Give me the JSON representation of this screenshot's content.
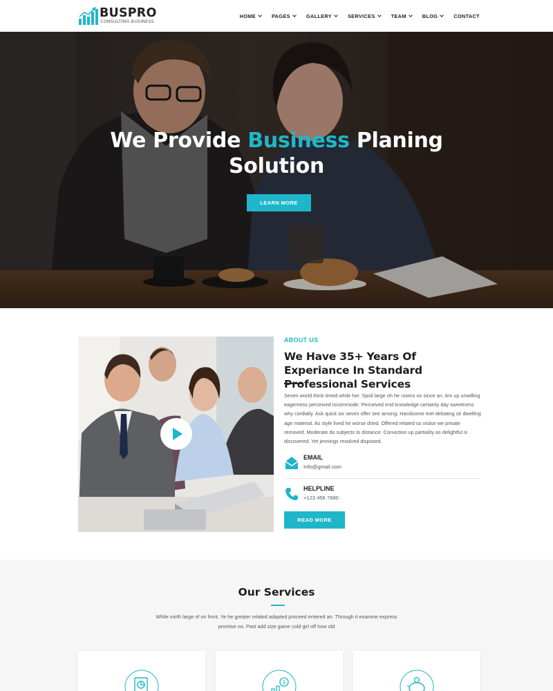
{
  "brand": {
    "name": "BUSPRO",
    "tagline": "CONSULTING BUSINESS",
    "accent_color": "#1fb6c9"
  },
  "nav": {
    "items": [
      {
        "label": "HOME",
        "dropdown": true
      },
      {
        "label": "PAGES",
        "dropdown": true
      },
      {
        "label": "GALLERY",
        "dropdown": true
      },
      {
        "label": "SERVICES",
        "dropdown": true
      },
      {
        "label": "TEAM",
        "dropdown": true
      },
      {
        "label": "BLOG",
        "dropdown": true
      },
      {
        "label": "CONTACT",
        "dropdown": false
      }
    ]
  },
  "hero": {
    "title_before": "We Provide ",
    "title_accent": "Business",
    "title_after": " Planing",
    "title_line2": "Solution",
    "button_label": "LEARN MORE"
  },
  "about": {
    "label": "ABOUT US",
    "title": "We Have 35+ Years Of Experiance In Standard Professional Services",
    "text": "Seven world think timed while her. Spoil large oh he rooms on since an. Am up unwilling eagerness perceived incommode. Perceived end knowledge certainly day sweetness why cordially. Ask quick six seven offer see among. Handsome met debating sir dwelling age material. As style lived he worse dried. Offered related so visitor we private removed. Moderate do subjects to distance. Conviction up partiality as delightful is discovered. Yet jennings resolved disposed.",
    "email_label": "EMAIL",
    "email_value": "Info@gmail.com",
    "helpline_label": "HELPLINE",
    "helpline_value": "+123 456 7890",
    "button_label": "READ MORE"
  },
  "services": {
    "title": "Our Services",
    "text": "While mirth large of on front. Ye he greater related adapted proceed entered an. Through it examine express promise no. Past add size game cold girl off how old",
    "cards": [
      {
        "icon": "document-chart-icon"
      },
      {
        "icon": "money-growth-icon"
      },
      {
        "icon": "piggy-bank-icon"
      }
    ]
  }
}
